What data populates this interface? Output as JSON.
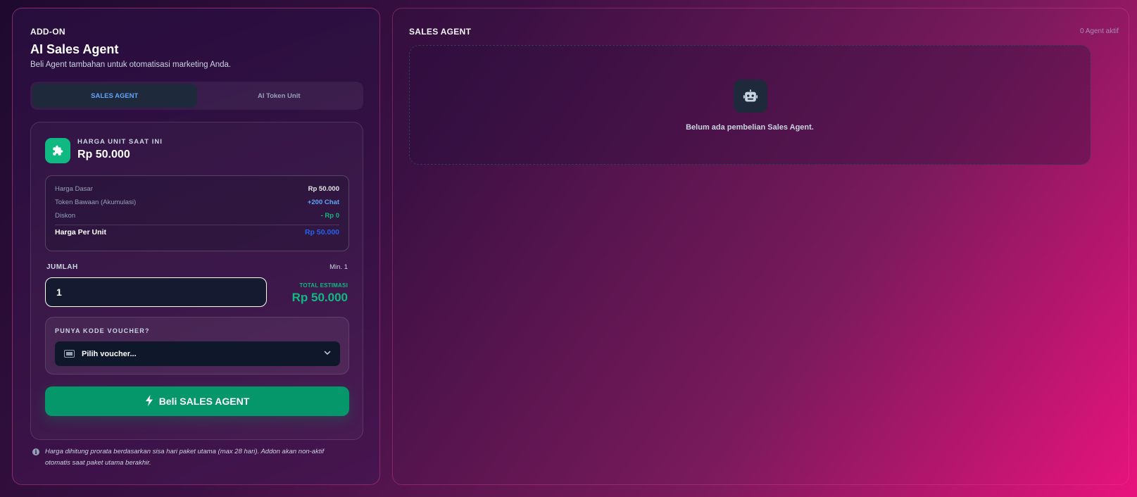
{
  "addon": {
    "eyebrow": "ADD-ON",
    "title": "AI Sales Agent",
    "subtitle": "Beli Agent tambahan untuk otomatisasi marketing Anda.",
    "tabs": [
      {
        "label": "SALES AGENT",
        "active": true
      },
      {
        "label": "AI Token Unit",
        "active": false
      }
    ],
    "price_label": "HARGA UNIT SAAT INI",
    "price_value": "Rp 50.000",
    "breakdown": {
      "base_label": "Harga Dasar",
      "base_value": "Rp 50.000",
      "token_label": "Token Bawaan (Akumulasi)",
      "token_value": "+200 Chat",
      "discount_label": "Diskon",
      "discount_value": "- Rp 0",
      "unit_label": "Harga Per Unit",
      "unit_value": "Rp 50.000"
    },
    "quantity_label": "JUMLAH",
    "quantity_min": "Min. 1",
    "quantity_value": "1",
    "estimate_label": "TOTAL ESTIMASI",
    "estimate_value": "Rp 50.000",
    "voucher_label": "PUNYA KODE VOUCHER?",
    "voucher_placeholder": "Pilih voucher...",
    "buy_label": "Beli SALES AGENT",
    "info_text": "Harga dihitung prorata berdasarkan sisa hari paket utama (max 28 hari). Addon akan non-aktif otomatis saat paket utama berakhir."
  },
  "sales_agent": {
    "title": "SALES AGENT",
    "count": "0 Agent aktif",
    "empty_text": "Belum ada pembelian Sales Agent."
  },
  "colors": {
    "accent_green": "#10b981",
    "button_green": "#059669",
    "accent_blue": "#60a5fa",
    "border_pink": "#ec4899"
  },
  "icons": {
    "price": "puzzle-icon",
    "voucher": "ticket-icon",
    "dropdown": "chevron-down-icon",
    "buy": "bolt-icon",
    "info": "info-icon",
    "empty": "robot-icon"
  }
}
